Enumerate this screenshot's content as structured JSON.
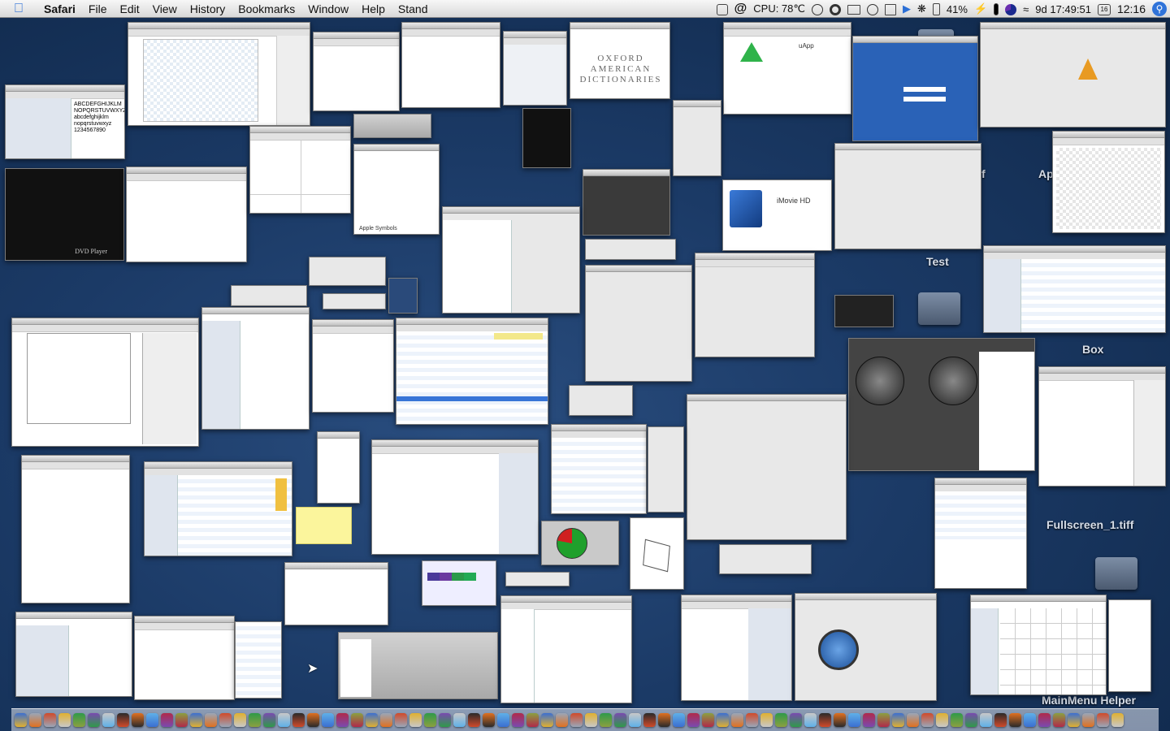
{
  "menubar": {
    "app_name": "Safari",
    "menus": [
      "File",
      "Edit",
      "View",
      "History",
      "Bookmarks",
      "Window",
      "Help",
      "Stand"
    ],
    "cpu": "CPU: 78℃",
    "battery": "41%",
    "time_remaining": "9d 17:49:51",
    "clock": "12:16",
    "calendar_day": "16"
  },
  "windows": {
    "font_sample": "ABCDEFGHIJKLM\nNOPQRSTUVWXYZ\nabcdefghijklm\nnopqrstuvwxyz\n1234567890",
    "dictionary_title": "OXFORD AMERICAN DICTIONARIES",
    "dvd_player": "DVD Player",
    "uapp": "uApp",
    "imovie": "iMovie HD",
    "apple_symbols": "Apple Symbols"
  },
  "desktop_icons": {
    "test": "Test",
    "box": "Box",
    "fullscreen": "Fullscreen_1.tiff",
    "mainmenu": "MainMenu Helper",
    "ap": "Ap",
    "f": "f"
  },
  "colors": {
    "accent": "#2f73d9",
    "sticky": "#fbf59c"
  }
}
